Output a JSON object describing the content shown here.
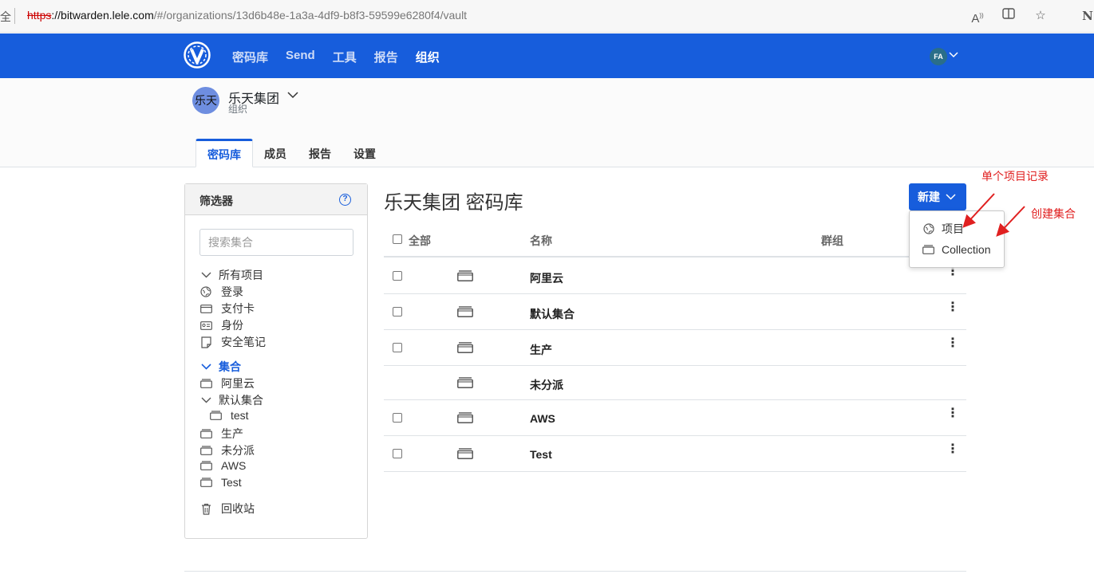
{
  "browser": {
    "left_fragment": "全",
    "url_protocol": "https",
    "url_host": "://bitwarden.lele.com",
    "url_path": "/#/organizations/13d6b48e-1a3a-4df9-b8f3-59599e6280f4/vault",
    "icons": [
      "read-aloud-icon",
      "split-screen-icon",
      "favorite-star-icon",
      "notion-icon"
    ]
  },
  "topnav": {
    "links": [
      "密码库",
      "Send",
      "工具",
      "报告",
      "组织"
    ],
    "active_index": 4,
    "avatar_initials": "FA",
    "colors": {
      "nav_bg": "#175ddc",
      "avatar_bg": "#2a6e89"
    }
  },
  "org": {
    "avatar_text": "乐天",
    "name": "乐天集团",
    "subtitle": "组织",
    "tabs": [
      "密码库",
      "成员",
      "报告",
      "设置"
    ],
    "active_tab": 0
  },
  "filter": {
    "title": "筛选器",
    "search_placeholder": "搜索集合",
    "items": [
      {
        "label": "所有项目",
        "icon": "chevron-down-icon",
        "type": "toggle"
      },
      {
        "label": "登录",
        "icon": "globe-icon"
      },
      {
        "label": "支付卡",
        "icon": "card-icon"
      },
      {
        "label": "身份",
        "icon": "id-card-icon"
      },
      {
        "label": "安全笔记",
        "icon": "note-icon"
      },
      {
        "label": "集合",
        "icon": "chevron-down-icon",
        "type": "section"
      },
      {
        "label": "阿里云",
        "icon": "collection-icon"
      },
      {
        "label": "默认集合",
        "icon": "chevron-down-icon",
        "type": "toggle"
      },
      {
        "label": "test",
        "icon": "collection-icon",
        "nested": true
      },
      {
        "label": "生产",
        "icon": "collection-icon"
      },
      {
        "label": "未分派",
        "icon": "collection-icon"
      },
      {
        "label": "AWS",
        "icon": "collection-icon"
      },
      {
        "label": "Test",
        "icon": "collection-icon"
      },
      {
        "label": "回收站",
        "icon": "trash-icon"
      }
    ]
  },
  "main": {
    "title": "乐天集团 密码库",
    "new_button": "新建",
    "headers": {
      "all": "全部",
      "name": "名称",
      "groups": "群组"
    },
    "rows": [
      {
        "name": "阿里云",
        "checkbox": true,
        "menu": true
      },
      {
        "name": "默认集合",
        "checkbox": true,
        "menu": true
      },
      {
        "name": "生产",
        "checkbox": true,
        "menu": true
      },
      {
        "name": "未分派",
        "checkbox": false,
        "menu": false
      },
      {
        "name": "AWS",
        "checkbox": true,
        "menu": true
      },
      {
        "name": "Test",
        "checkbox": true,
        "menu": true
      }
    ],
    "dropdown": [
      {
        "label": "项目",
        "icon": "globe-icon"
      },
      {
        "label": "Collection",
        "icon": "collection-icon"
      }
    ]
  },
  "annotations": {
    "single_item": "单个项目记录",
    "create_collection": "创建集合",
    "color": "#e02020"
  }
}
